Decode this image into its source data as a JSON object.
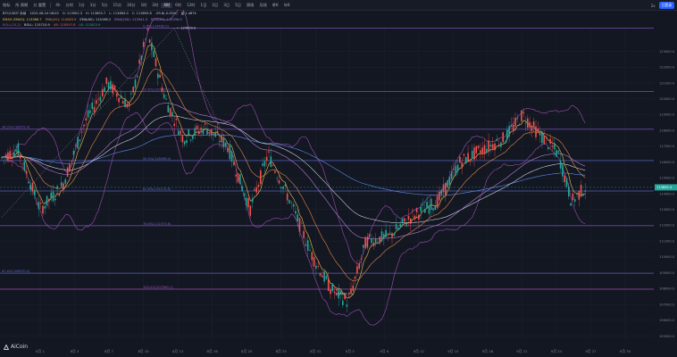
{
  "toolbar": {
    "items": [
      "指标",
      "所 周期",
      "分 重置",
      "4h",
      "分时",
      "1分",
      "3分",
      "5分",
      "15分",
      "30分",
      "1时",
      "2时",
      "4时",
      "6时",
      "12时",
      "1日",
      "2日",
      "3日",
      "5日",
      "周线",
      "月线",
      "季K",
      "年K"
    ],
    "active_index": 12,
    "right": [
      "2x",
      "已登录"
    ]
  },
  "info": {
    "row1": [
      "BTC/USDT 永续",
      "2025-08-24 08:00",
      "O: 113902.3",
      "H: 113893.7",
      "L: 113863.0",
      "C: 113893.8",
      "-59.8(-0.05%)",
      "量 1.487k"
    ],
    "row2": [
      "EMA5 (EMA5): 113386.7",
      "EMA(20): 114083.9",
      "EMA(60): 114198.2",
      "EMA(200): 113941.5",
      "EMA(80): 114356.0"
    ],
    "row3": [
      "BOLL(20,2)",
      "BOLL: 115710.9",
      "UB: 118597.8",
      "LB: 112823.9"
    ]
  },
  "chart_data": {
    "type": "candlestick",
    "symbol": "BTC/USDT",
    "y_ticks": [
      123000,
      122000,
      121000,
      120000,
      119000,
      118000,
      117000,
      116000,
      115000,
      114000,
      113000,
      112000,
      111000,
      110000,
      109000,
      108000,
      107000,
      106000,
      105000
    ],
    "x_labels": [
      "8月 1",
      "8月 4",
      "8月 7",
      "8月 10",
      "8月 13",
      "8月 16",
      "8月 20",
      "8月 25",
      "8月 31",
      "9月 3",
      "9月 6",
      "9月 12",
      "9月 15",
      "9月 18",
      "9月 21",
      "9月 24",
      "9月 27",
      "9月 30"
    ],
    "current_price_label": "113605.4",
    "peak_label": "124500.0",
    "low_label": "107000.7",
    "fib_levels": [
      {
        "label": "0.0%(124480.0)",
        "price": 124480,
        "color": "#7e57c2"
      },
      {
        "label": "23.6%(120469.1)",
        "price": 120469,
        "color": "#7e57c2"
      },
      {
        "label": "38.2%(118079.4)",
        "price": 118080,
        "color": "#7e57c2"
      },
      {
        "label": "50.0%(116098.4)",
        "price": 116098,
        "color": "#5c6bc0"
      },
      {
        "label": "61.8%(114170.0)",
        "price": 114170,
        "color": "#5c6bc0"
      },
      {
        "label": "78.6%(111973.6)",
        "price": 111974,
        "color": "#7e57c2"
      },
      {
        "label": "61.8%(108970.4)",
        "price": 108970,
        "color": "#5c6bc0"
      },
      {
        "label": "100.0%(107960.1)",
        "price": 107960,
        "color": "#ab47bc"
      }
    ],
    "colors": {
      "up": "#26a69a",
      "down": "#ef5350",
      "ema_yellow": "#f2c14e",
      "ema_orange": "#e0884a",
      "ema_purple": "#b57fd6",
      "ema_white": "#cfd3dc",
      "boll": "#9c4fb0",
      "fib": "#7e57c2"
    }
  },
  "logo": "AiCoin"
}
